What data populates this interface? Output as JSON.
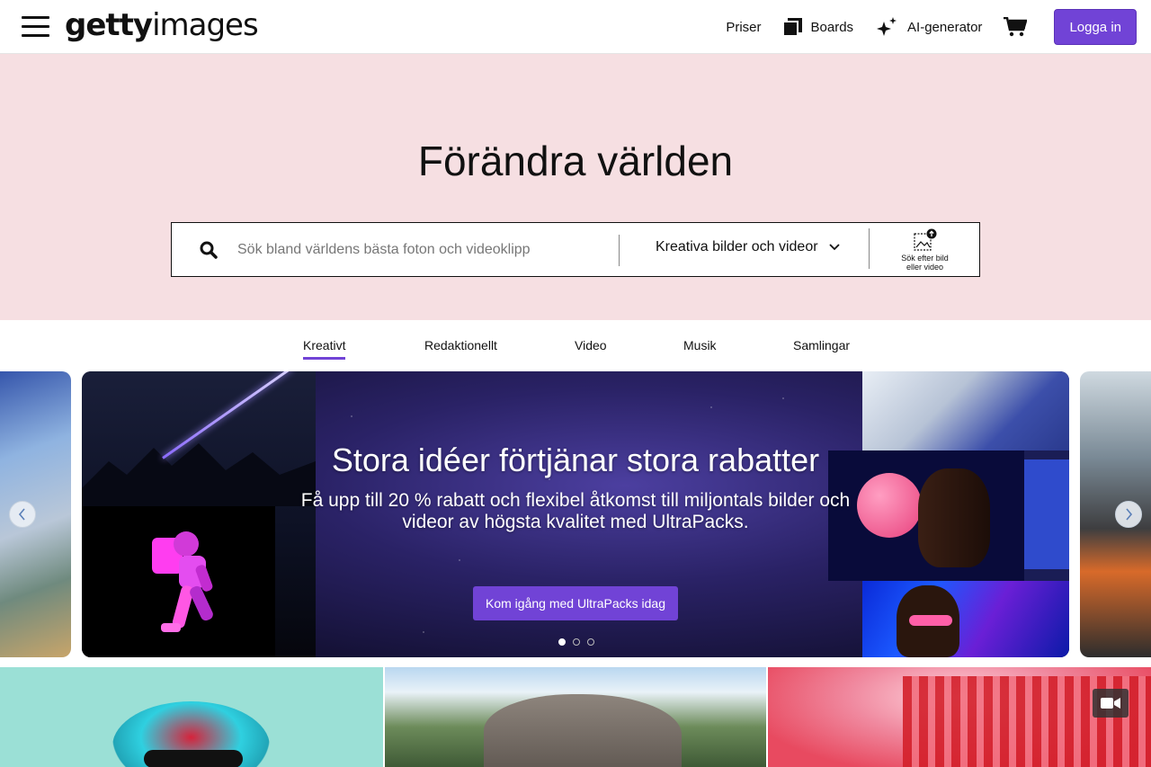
{
  "header": {
    "logo_bold": "getty",
    "logo_light": "images",
    "nav": {
      "pricing": "Priser",
      "boards": "Boards",
      "ai_generator": "AI-generator",
      "login": "Logga in"
    }
  },
  "hero": {
    "title": "Förändra världen",
    "search": {
      "placeholder": "Sök bland världens bästa foton och videoklipp",
      "value": "",
      "type_selected": "Kreativa bilder och videor",
      "image_search_line1": "Sök efter bild",
      "image_search_line2": "eller video"
    }
  },
  "tabs": [
    "Kreativt",
    "Redaktionellt",
    "Video",
    "Musik",
    "Samlingar"
  ],
  "active_tab": "Kreativt",
  "banner": {
    "title": "Stora idéer förtjänar stora rabatter",
    "subtitle": "Få upp till 20 % rabatt och flexibel åtkomst till miljontals bilder och videor av högsta kvalitet med UltraPacks.",
    "cta": "Kom igång med UltraPacks idag",
    "slides": 3,
    "active_slide": 1
  },
  "colors": {
    "accent": "#7143d6",
    "hero_bg": "#f6dfe2"
  },
  "icons": [
    "hamburger-icon",
    "boards-icon",
    "sparkle-icon",
    "cart-icon",
    "search-icon",
    "chevron-down-icon",
    "image-upload-icon",
    "chevron-left-icon",
    "chevron-right-icon",
    "video-camera-icon"
  ]
}
